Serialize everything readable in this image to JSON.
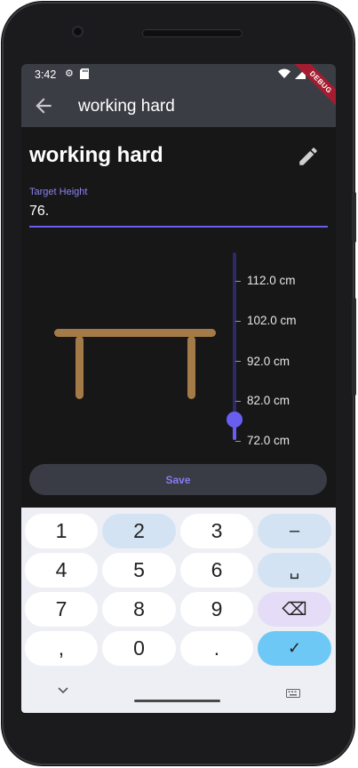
{
  "status_bar": {
    "time": "3:42",
    "icons": [
      "settings-icon",
      "sd-card-icon",
      "wifi-icon",
      "signal-icon",
      "battery-icon"
    ]
  },
  "debug_banner": "DEBUG",
  "app_bar": {
    "title": "working hard",
    "back_icon": "arrow-back-icon"
  },
  "page": {
    "title": "working hard",
    "edit_icon": "pencil-icon",
    "target_height": {
      "label": "Target Height",
      "value": "76."
    }
  },
  "slider": {
    "labels": [
      "112.0 cm",
      "102.0 cm",
      "92.0 cm",
      "82.0 cm",
      "72.0 cm"
    ],
    "min_cm": 72.0,
    "max_cm": 112.0,
    "value_cm": 76.0
  },
  "save_label": "Save",
  "keyboard": {
    "row1": [
      "1",
      "2",
      "3",
      "–"
    ],
    "row2": [
      "4",
      "5",
      "6",
      "␣"
    ],
    "row3": [
      "7",
      "8",
      "9",
      "⌫"
    ],
    "row4": [
      ",",
      "0",
      ".",
      "✓"
    ],
    "bottom_icons": [
      "chevron-down-icon",
      "keyboard-icon"
    ]
  },
  "colors": {
    "accent": "#6a5ef0",
    "appbar": "#3a3d44",
    "table": "#a47a48",
    "done_key": "#6dc8f5"
  }
}
